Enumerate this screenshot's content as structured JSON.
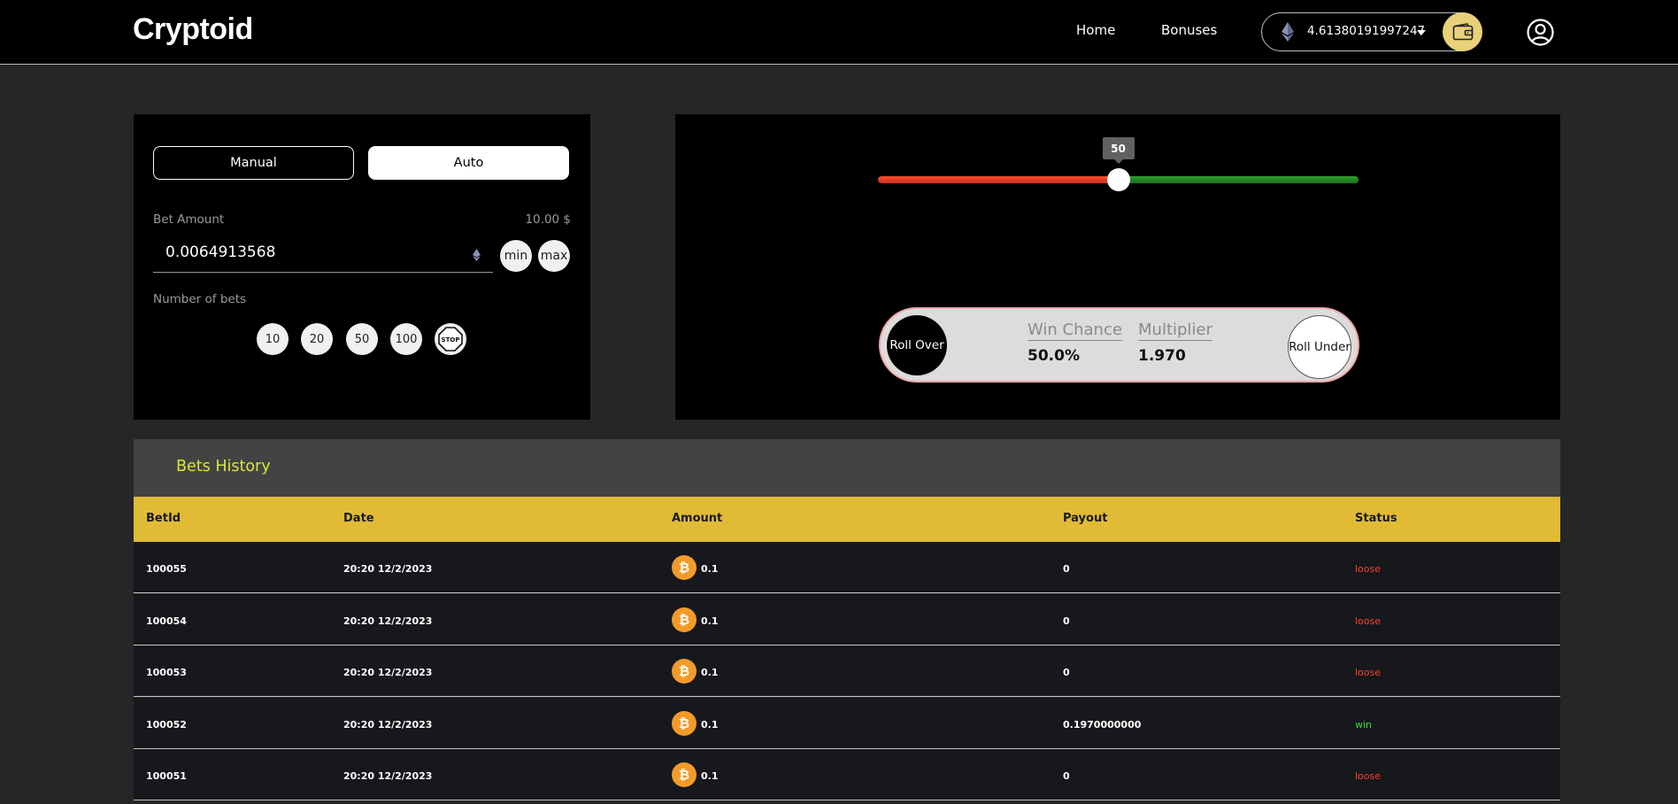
{
  "header": {
    "logo": "Cryptoid",
    "nav": [
      {
        "label": "Home"
      },
      {
        "label": "Bonuses"
      }
    ],
    "balance": "4.61380191997247",
    "wallet_icon": "wallet-icon",
    "user_icon": "user-circle-icon"
  },
  "bet_panel": {
    "tabs": [
      {
        "label": "Manual"
      },
      {
        "label": "Auto"
      }
    ],
    "active_tab": "Auto",
    "bet_amount_label": "Bet Amount",
    "bet_amount_usd": "10.00 $",
    "bet_amount_value": "0.0064913568",
    "min_label": "min",
    "max_label": "max",
    "number_of_bets_label": "Number of bets",
    "bet_counts": [
      "10",
      "20",
      "50",
      "100"
    ],
    "stop_label": "STOP"
  },
  "dice": {
    "slider_value": 50,
    "slider_label": "50",
    "roll_over_label": "Roll Over",
    "roll_under_label": "Roll Under",
    "win_chance_label": "Win Chance",
    "win_chance_value": "50.0%",
    "multiplier_label": "Multiplier",
    "multiplier_value": "1.970"
  },
  "history": {
    "title": "Bets History",
    "columns": [
      "BetId",
      "Date",
      "Amount",
      "Payout",
      "Status"
    ],
    "rows": [
      {
        "betid": "100055",
        "date": "20:20 12/2/2023",
        "amount": "0.1",
        "payout": "0",
        "status": "loose"
      },
      {
        "betid": "100054",
        "date": "20:20 12/2/2023",
        "amount": "0.1",
        "payout": "0",
        "status": "loose"
      },
      {
        "betid": "100053",
        "date": "20:20 12/2/2023",
        "amount": "0.1",
        "payout": "0",
        "status": "loose"
      },
      {
        "betid": "100052",
        "date": "20:20 12/2/2023",
        "amount": "0.1",
        "payout": "0.1970000000",
        "status": "win"
      },
      {
        "betid": "100051",
        "date": "20:20 12/2/2023",
        "amount": "0.1",
        "payout": "0",
        "status": "loose"
      }
    ]
  },
  "colors": {
    "accent_yellow": "#e2bb36",
    "title_lime": "#d5e83a",
    "loss_red": "#ff3b2f",
    "win_green": "#3ddc32",
    "btc_orange": "#f29b2a"
  }
}
